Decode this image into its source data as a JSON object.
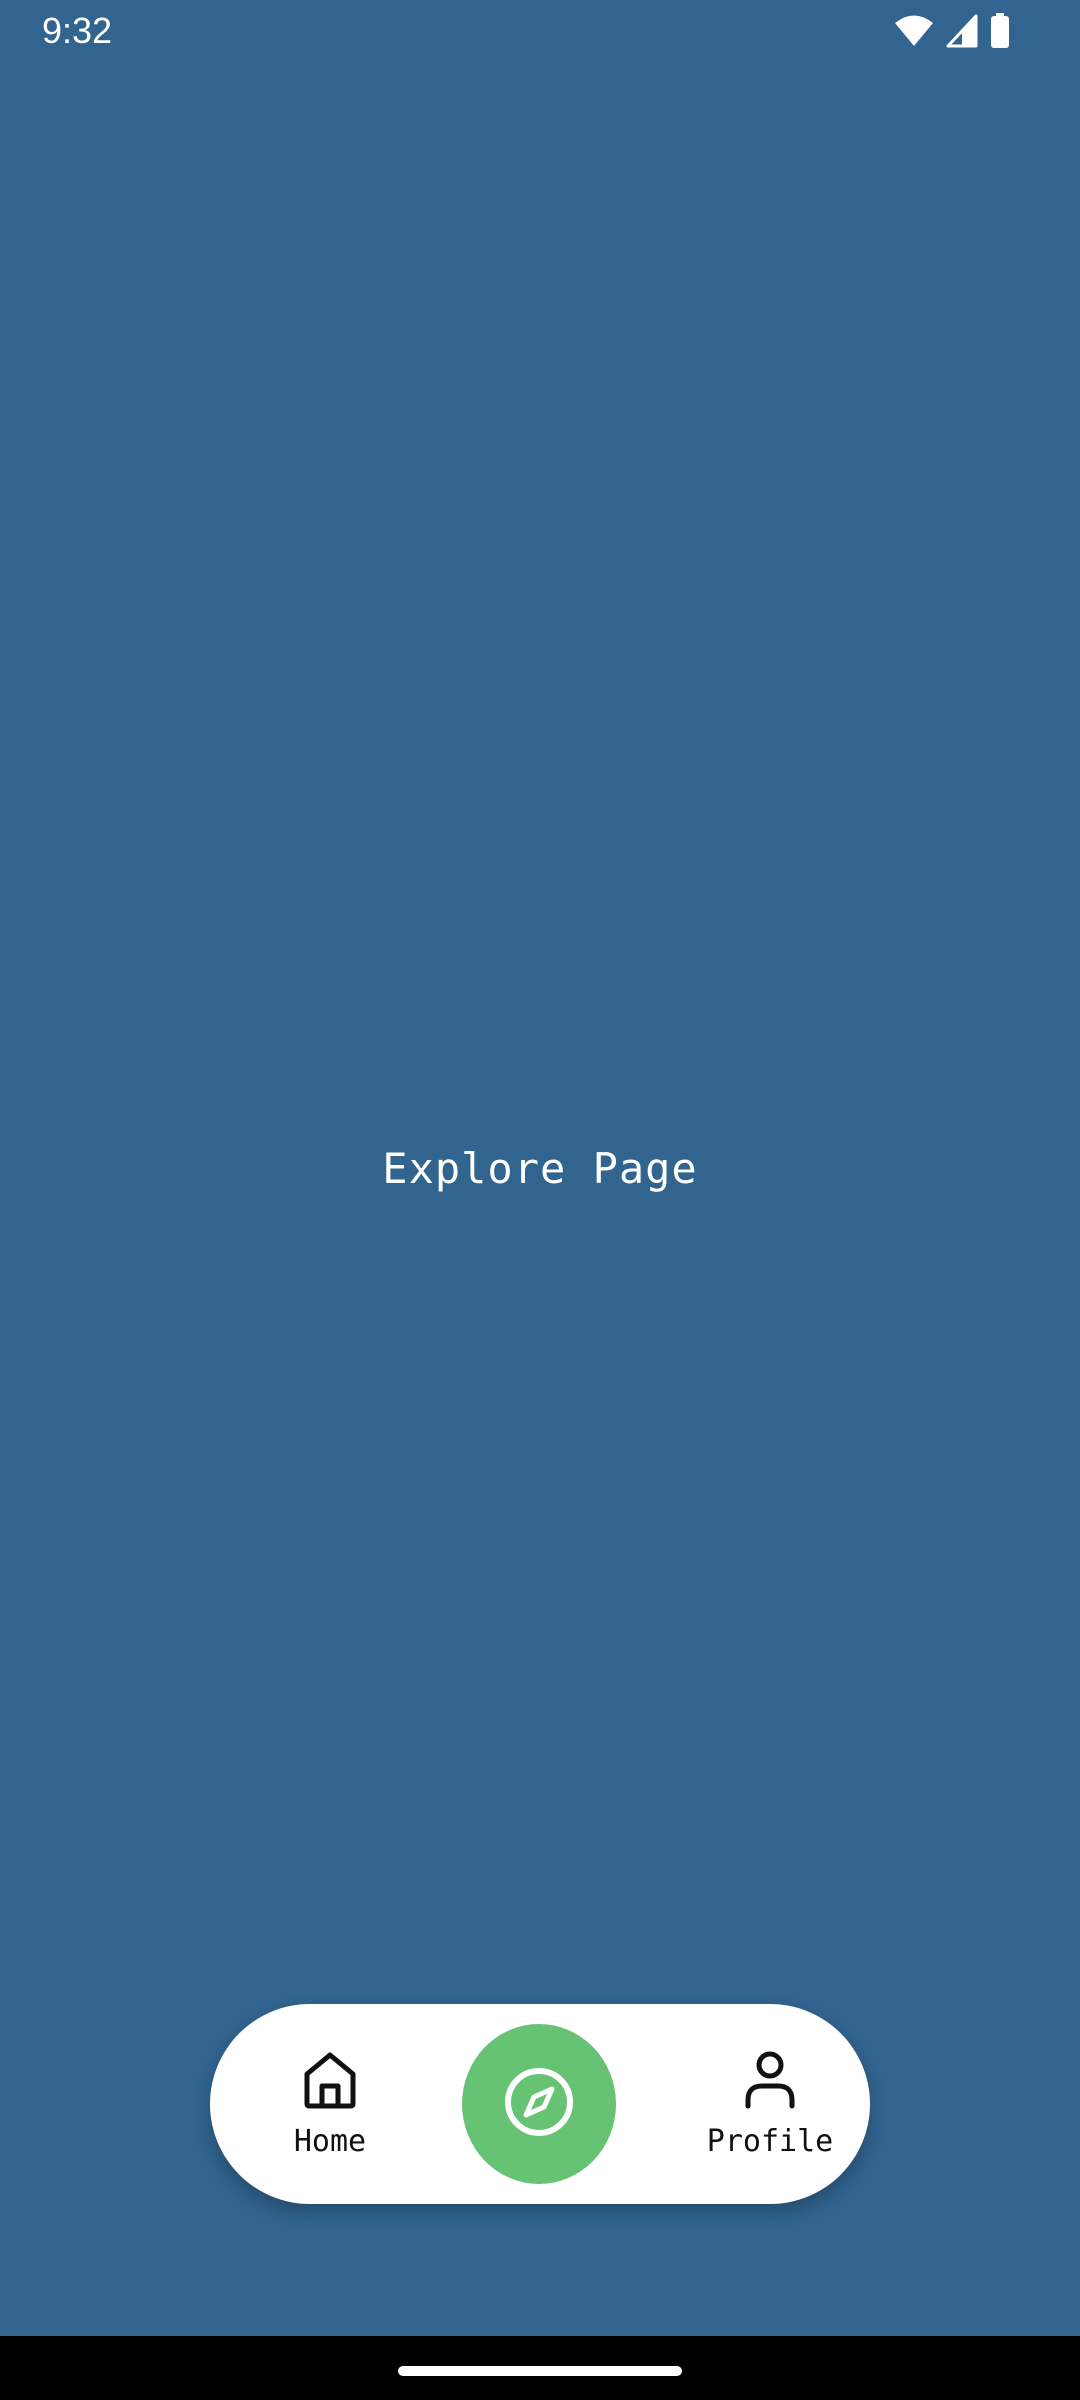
{
  "status_bar": {
    "time": "9:32",
    "icons": [
      "wifi-icon",
      "cellular-signal-icon",
      "battery-icon"
    ]
  },
  "main": {
    "title": "Explore Page",
    "background_color": "#31648f"
  },
  "bottom_nav": {
    "items": [
      {
        "label": "Home",
        "icon": "home-icon",
        "active": false
      },
      {
        "label": "",
        "icon": "compass-icon",
        "active": true
      },
      {
        "label": "Profile",
        "icon": "person-icon",
        "active": false
      }
    ],
    "active_color": "#66c373"
  }
}
